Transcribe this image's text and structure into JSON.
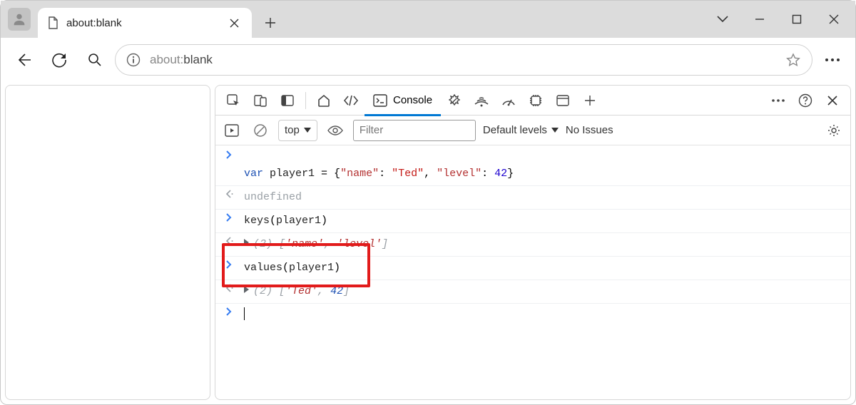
{
  "browser": {
    "tab_title": "about:blank",
    "url_prefix": "about:",
    "url_rest": "blank"
  },
  "devtools": {
    "tabs": {
      "console": "Console"
    },
    "console_bar": {
      "context": "top",
      "filter_placeholder": "Filter",
      "levels": "Default levels",
      "issues": "No Issues"
    },
    "console": {
      "line1": {
        "kw": "var",
        "var": "player1",
        "eq": " = {",
        "k1": "\"name\"",
        "sep1": ": ",
        "v1": "\"Ted\"",
        "comma": ", ",
        "k2": "\"level\"",
        "sep2": ": ",
        "v2": "42",
        "close": "}"
      },
      "line2": "undefined",
      "line3": {
        "fn": "keys",
        "arg": "player1"
      },
      "line4": {
        "count": "(2) ",
        "open": "[",
        "a": "'name'",
        "sep": ", ",
        "b": "'level'",
        "close": "]"
      },
      "line5": {
        "fn": "values",
        "arg": "player1"
      },
      "line6": {
        "count": "(2) ",
        "open": "[",
        "a": "'Ted'",
        "sep": ", ",
        "b": "42",
        "close": "]"
      }
    }
  }
}
